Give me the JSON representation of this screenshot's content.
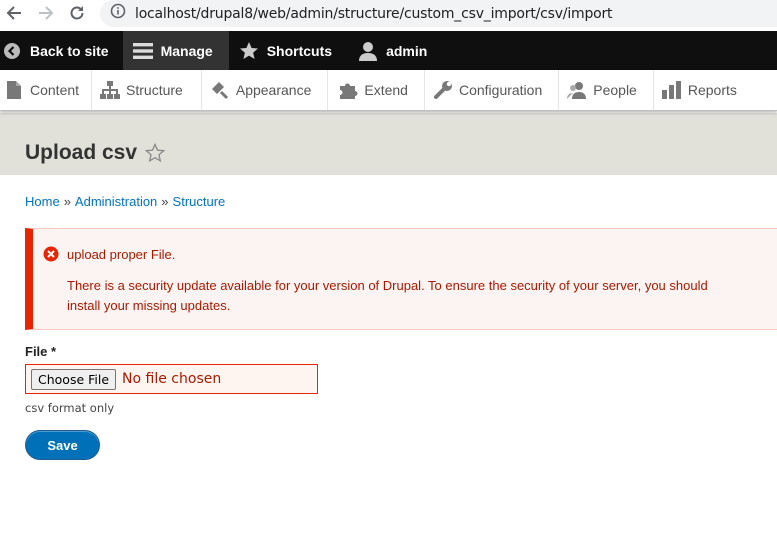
{
  "browser": {
    "url": "localhost/drupal8/web/admin/structure/custom_csv_import/csv/import"
  },
  "toolbar": {
    "back_label": "Back to site",
    "manage_label": "Manage",
    "shortcuts_label": "Shortcuts",
    "user_label": "admin"
  },
  "tray": {
    "items": [
      {
        "label": "Content",
        "icon": "content-icon"
      },
      {
        "label": "Structure",
        "icon": "structure-icon"
      },
      {
        "label": "Appearance",
        "icon": "appearance-icon"
      },
      {
        "label": "Extend",
        "icon": "extend-icon"
      },
      {
        "label": "Configuration",
        "icon": "configuration-icon"
      },
      {
        "label": "People",
        "icon": "people-icon"
      },
      {
        "label": "Reports",
        "icon": "reports-icon"
      }
    ]
  },
  "page": {
    "title": "Upload csv"
  },
  "breadcrumb": {
    "items": [
      "Home",
      "Administration",
      "Structure"
    ],
    "separator": "»"
  },
  "messages": {
    "error": "upload proper File.",
    "security_line1": "There is a security update available for your version of Drupal. To ensure the security of your server, you should",
    "security_line2": "install your missing updates."
  },
  "form": {
    "file_label": "File",
    "required_mark": "*",
    "choose_button": "Choose File",
    "file_status": "No file chosen",
    "description": "csv format only",
    "save_label": "Save"
  },
  "colors": {
    "toolbar": "#0f0f0f",
    "error_accent": "#e62600",
    "link": "#0074bd",
    "primary_button": "#0071b8"
  }
}
